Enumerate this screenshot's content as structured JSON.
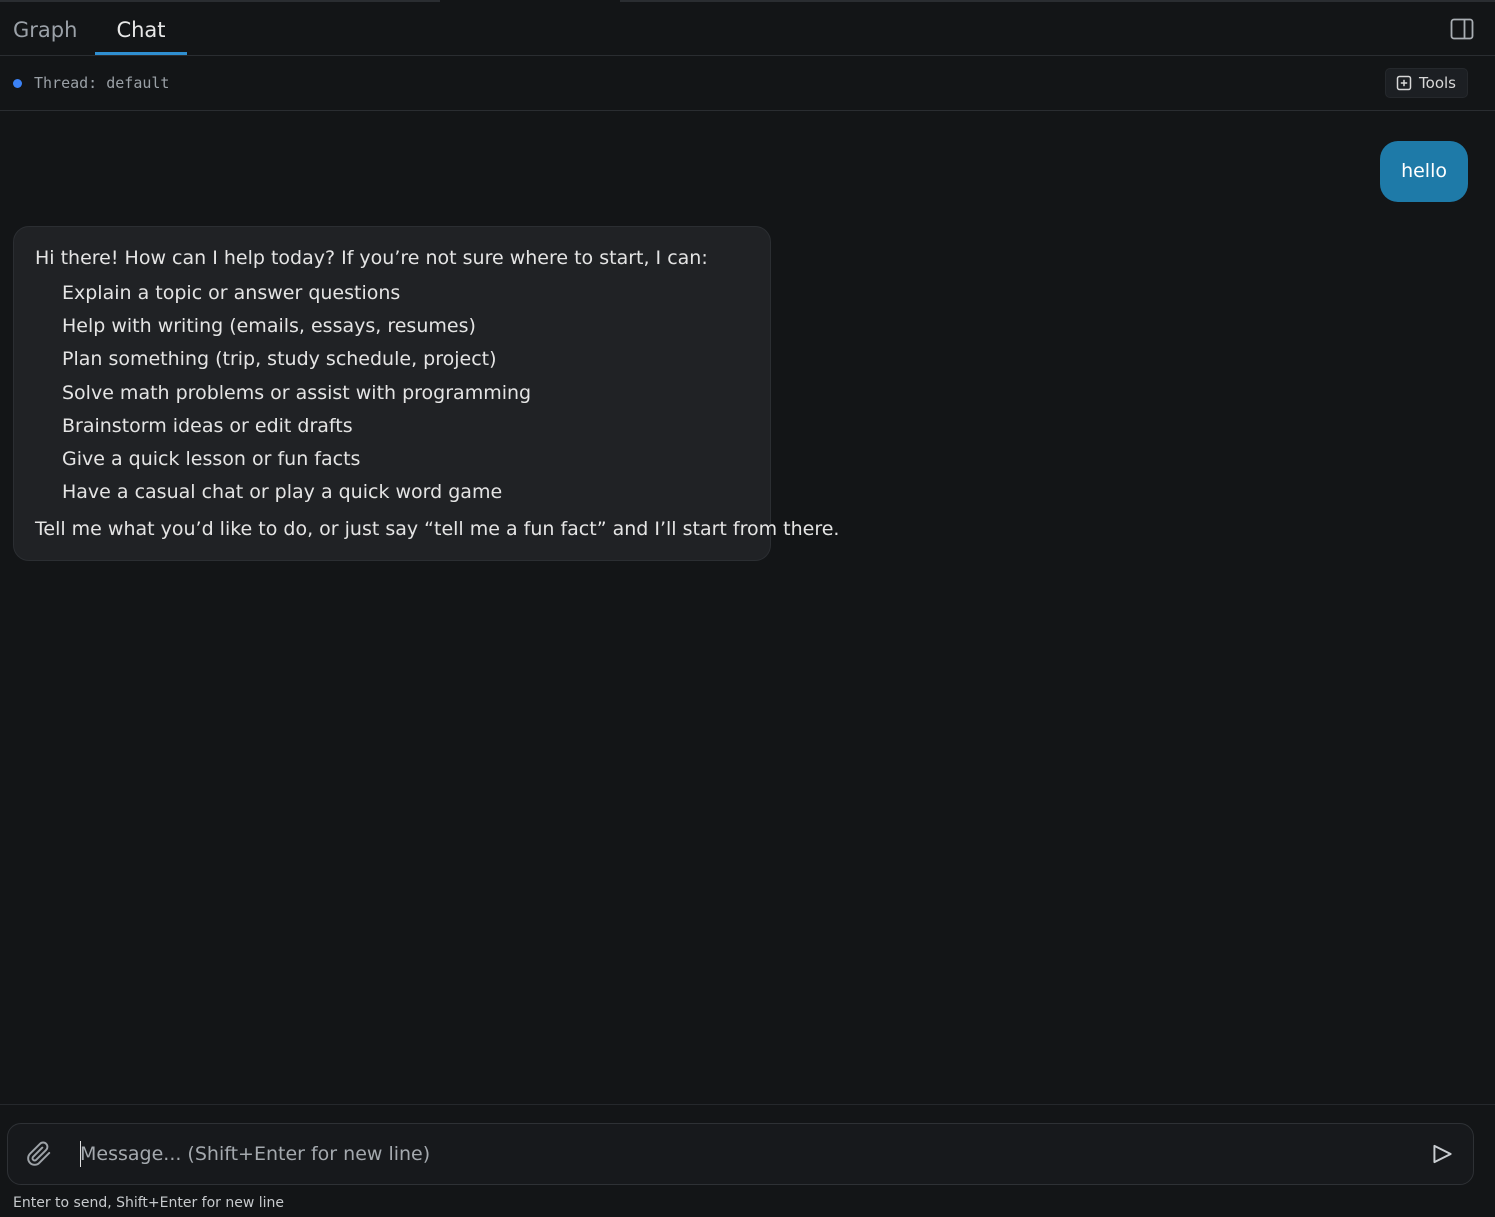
{
  "tabs": {
    "graph_label": "Graph",
    "chat_label": "Chat",
    "active": "Chat"
  },
  "header": {
    "panel_toggle_icon": "sidebar-panel-icon"
  },
  "thread": {
    "label": "Thread: default",
    "status_color": "#3b82f6",
    "tools_label": "Tools",
    "tools_icon": "plus-square-icon"
  },
  "messages": {
    "user": {
      "text": "hello",
      "bubble_color": "#1e7aa8"
    },
    "assistant": {
      "intro": "Hi there! How can I help today? If you’re not sure where to start, I can:",
      "items": [
        "Explain a topic or answer questions",
        "Help with writing (emails, essays, resumes)",
        "Plan something (trip, study schedule, project)",
        "Solve math problems or assist with programming",
        "Brainstorm ideas or edit drafts",
        "Give a quick lesson or fun facts",
        "Have a casual chat or play a quick word game"
      ],
      "outro": "Tell me what you’d like to do, or just say “tell me a fun fact” and I’ll start from there."
    }
  },
  "composer": {
    "placeholder": "Message... (Shift+Enter for new line)",
    "value": "",
    "attach_icon": "paperclip-icon",
    "send_icon": "send-icon",
    "hint": "Enter to send, Shift+Enter for new line"
  },
  "colors": {
    "background": "#131517",
    "accent": "#2f8fd1",
    "assistant_bubble": "#202225"
  }
}
